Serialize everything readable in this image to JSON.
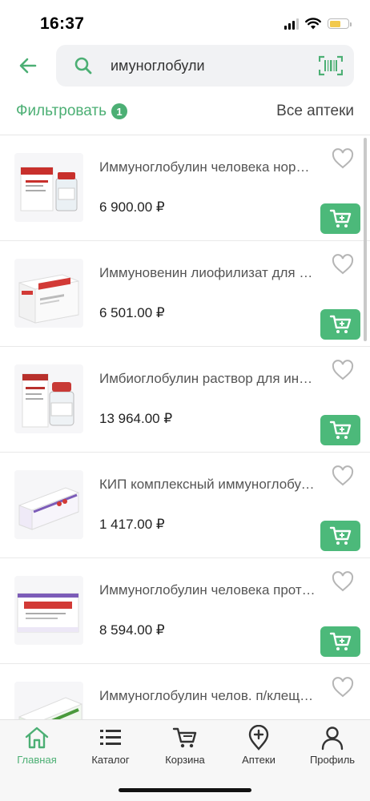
{
  "status": {
    "time": "16:37"
  },
  "search": {
    "value": "имуноглобули"
  },
  "filter": {
    "label": "Фильтровать",
    "count": "1",
    "pharmacy": "Все аптеки"
  },
  "products": [
    {
      "name": "Иммуноглобулин человека нормальный",
      "price": "6 900.00 ₽",
      "image": "vial-box-icon"
    },
    {
      "name": "Иммуновенин лиофилизат для приготовления",
      "price": "6 501.00 ₽",
      "image": "box-icon"
    },
    {
      "name": "Имбиоглобулин раствор для инфузий",
      "price": "13 964.00 ₽",
      "image": "vial-box-icon"
    },
    {
      "name": "КИП комплексный иммуноглобулиновый",
      "price": "1 417.00 ₽",
      "image": "box-icon"
    },
    {
      "name": "Иммуноглобулин человека против",
      "price": "8 594.00 ₽",
      "image": "box-icon"
    },
    {
      "name": "Иммуноглобулин челов. п/клещевого",
      "price": "",
      "image": "box-icon"
    }
  ],
  "nav": [
    {
      "label": "Главная",
      "icon": "home-icon",
      "active": true
    },
    {
      "label": "Каталог",
      "icon": "list-icon",
      "active": false
    },
    {
      "label": "Корзина",
      "icon": "cart-icon",
      "active": false
    },
    {
      "label": "Аптеки",
      "icon": "location-plus-icon",
      "active": false
    },
    {
      "label": "Профиль",
      "icon": "profile-icon",
      "active": false
    }
  ],
  "colors": {
    "accent": "#4caf74",
    "cart_button": "#4cb97a"
  }
}
